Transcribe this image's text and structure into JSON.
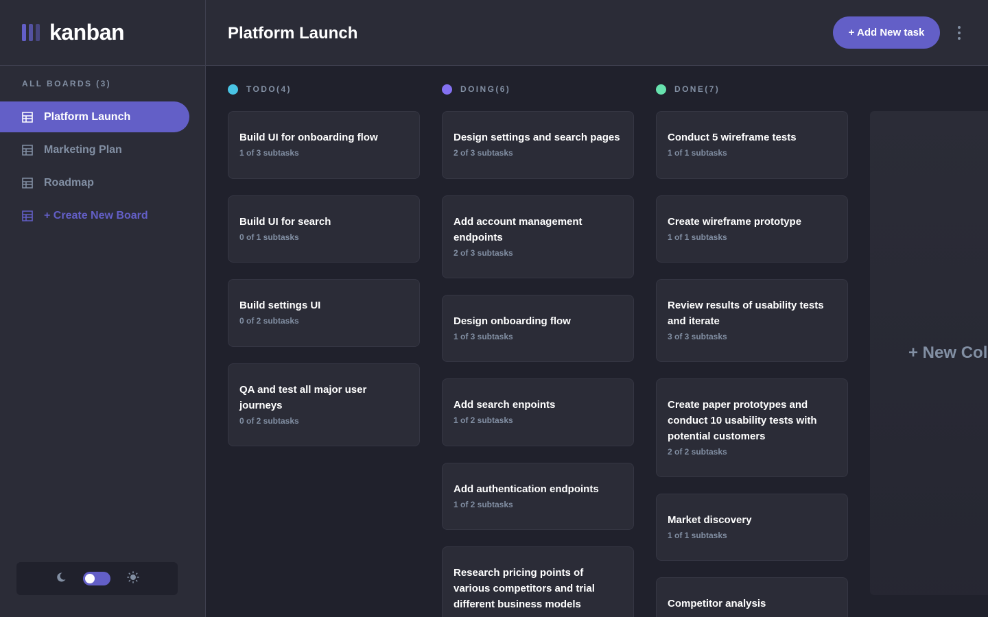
{
  "app": {
    "logo_text": "kanban"
  },
  "sidebar": {
    "heading": "ALL BOARDS (3)",
    "boards": [
      {
        "label": "Platform Launch",
        "active": true
      },
      {
        "label": "Marketing Plan",
        "active": false
      },
      {
        "label": "Roadmap",
        "active": false
      }
    ],
    "create_label": "+ Create New Board",
    "theme": {
      "dark_icon": "moon-icon",
      "light_icon": "sun-icon",
      "mode": "dark"
    }
  },
  "header": {
    "title": "Platform Launch",
    "add_task_label": "+ Add New task",
    "menu_icon": "vertical-ellipsis-icon"
  },
  "columns": [
    {
      "title": "TODO(4)",
      "color": "#49c4e5",
      "tasks": [
        {
          "title": "Build UI for onboarding flow",
          "subtasks": "1 of 3 subtasks"
        },
        {
          "title": "Build UI for search",
          "subtasks": "0 of 1 subtasks"
        },
        {
          "title": "Build settings UI",
          "subtasks": "0 of 2 subtasks"
        },
        {
          "title": "QA and test all major user journeys",
          "subtasks": "0 of 2 subtasks"
        }
      ]
    },
    {
      "title": "DOING(6)",
      "color": "#8471f2",
      "tasks": [
        {
          "title": "Design settings and search pages",
          "subtasks": "2 of 3 subtasks"
        },
        {
          "title": "Add account management endpoints",
          "subtasks": "2 of 3 subtasks"
        },
        {
          "title": "Design onboarding flow",
          "subtasks": "1 of 3 subtasks"
        },
        {
          "title": "Add search enpoints",
          "subtasks": "1 of 2 subtasks"
        },
        {
          "title": "Add authentication endpoints",
          "subtasks": "1 of 2 subtasks"
        },
        {
          "title": "Research pricing points of various competitors and trial different business models",
          "subtasks": ""
        }
      ]
    },
    {
      "title": "DONE(7)",
      "color": "#67e2ae",
      "tasks": [
        {
          "title": "Conduct 5 wireframe tests",
          "subtasks": "1 of 1 subtasks"
        },
        {
          "title": "Create wireframe prototype",
          "subtasks": "1 of 1 subtasks"
        },
        {
          "title": "Review results of usability tests and iterate",
          "subtasks": "3 of 3 subtasks"
        },
        {
          "title": "Create paper prototypes and conduct 10 usability tests with potential customers",
          "subtasks": "2 of 2 subtasks"
        },
        {
          "title": "Market discovery",
          "subtasks": "1 of 1 subtasks"
        },
        {
          "title": "Competitor analysis",
          "subtasks": ""
        }
      ]
    }
  ],
  "new_column_label": "+ New Column"
}
